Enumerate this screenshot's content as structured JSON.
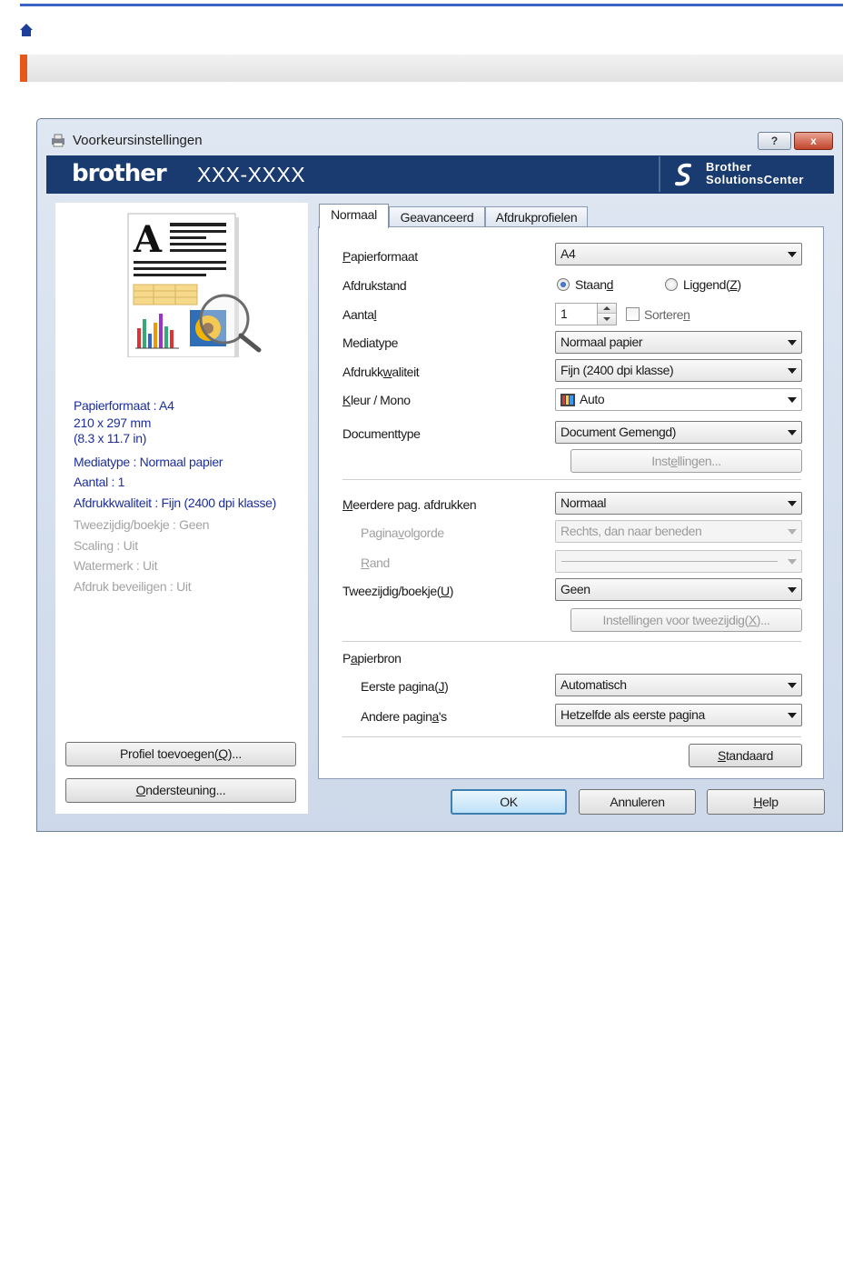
{
  "page": {
    "home_icon": "home-icon",
    "accent_color": "#e8571a"
  },
  "dialog": {
    "title": "Voorkeursinstellingen",
    "help_button": "?",
    "close_button": "x",
    "brand": "brother",
    "model": "XXX-XXXX",
    "solutions_line1": "Brother",
    "solutions_line2": "SolutionsCenter",
    "brand_color": "#1a3b6f"
  },
  "left_panel": {
    "summary": [
      {
        "text": "Papierformaat : A4",
        "active": true
      },
      {
        "text": "210 x 297 mm",
        "active": true
      },
      {
        "text": "(8.3 x 11.7 in)",
        "active": true
      },
      {
        "text": "Mediatype : Normaal papier",
        "active": true
      },
      {
        "text": "Aantal : 1",
        "active": true
      },
      {
        "text": "Afdrukkwaliteit : Fijn (2400 dpi klasse)",
        "active": true
      },
      {
        "text": "Tweezijdig/boekje : Geen",
        "active": false
      },
      {
        "text": "Scaling : Uit",
        "active": false
      },
      {
        "text": "Watermerk : Uit",
        "active": false
      },
      {
        "text": "Afdruk beveiligen : Uit",
        "active": false
      }
    ],
    "add_profile_pre": "Profiel toevoegen(",
    "add_profile_key": "Q",
    "add_profile_post": ")...",
    "support_key": "O",
    "support_rest": "ndersteuning..."
  },
  "tabs": [
    "Normaal",
    "Geavanceerd",
    "Afdrukprofielen"
  ],
  "normal_tab": {
    "paper_size": {
      "label_key": "P",
      "label_rest": "apierformaat",
      "value": "A4"
    },
    "orientation": {
      "label": "Afdrukstand",
      "portrait_pre": "Staan",
      "portrait_key": "d",
      "landscape_pre": "Liggend(",
      "landscape_key": "Z",
      "landscape_post": ")",
      "selected": "portrait"
    },
    "copies": {
      "label_pre": "Aanta",
      "label_key": "l",
      "value": "1",
      "sort_pre": "Sortere",
      "sort_key": "n",
      "sort_checked": false
    },
    "media_type": {
      "label": "Mediatype",
      "value": "Normaal papier"
    },
    "print_quality": {
      "label_pre": "Afdrukk",
      "label_key": "w",
      "label_post": "aliteit",
      "value": "Fijn (2400 dpi klasse)"
    },
    "color_mono": {
      "label_key": "K",
      "label_rest": "leur / Mono",
      "value": "Auto",
      "icon": "color-palette-icon"
    },
    "document_type": {
      "label": "Documenttype",
      "value": "Document Gemengd)"
    },
    "settings_button_pre": "Inst",
    "settings_button_key": "e",
    "settings_button_post": "llingen...",
    "multiple_pages": {
      "label_key": "M",
      "label_rest": "eerdere pag. afdrukken",
      "value": "Normaal"
    },
    "page_order": {
      "label_pre": "Pagina",
      "label_key": "v",
      "label_post": "olgorde",
      "value": "Rechts, dan naar beneden"
    },
    "border": {
      "label_key": "R",
      "label_rest": "and"
    },
    "duplex": {
      "label_pre": "Tweezijdig/boekje(",
      "label_key": "U",
      "label_post": ")",
      "value": "Geen"
    },
    "duplex_settings_pre": "Instellingen voor tweezijdig(",
    "duplex_settings_key": "X",
    "duplex_settings_post": ")...",
    "paper_source": {
      "label_pre": "P",
      "label_key": "a",
      "label_post": "pierbron"
    },
    "first_page": {
      "label_pre": "Eerste pagina(",
      "label_key": "J",
      "label_post": ")",
      "value": "Automatisch"
    },
    "other_pages": {
      "label_pre": "Andere pagin",
      "label_key": "a",
      "label_post": "'s",
      "value": "Hetzelfde als eerste pagina"
    },
    "default_button_key": "S",
    "default_button_rest": "tandaard"
  },
  "buttons": {
    "ok": "OK",
    "cancel": "Annuleren",
    "help_key": "H",
    "help_rest": "elp"
  }
}
